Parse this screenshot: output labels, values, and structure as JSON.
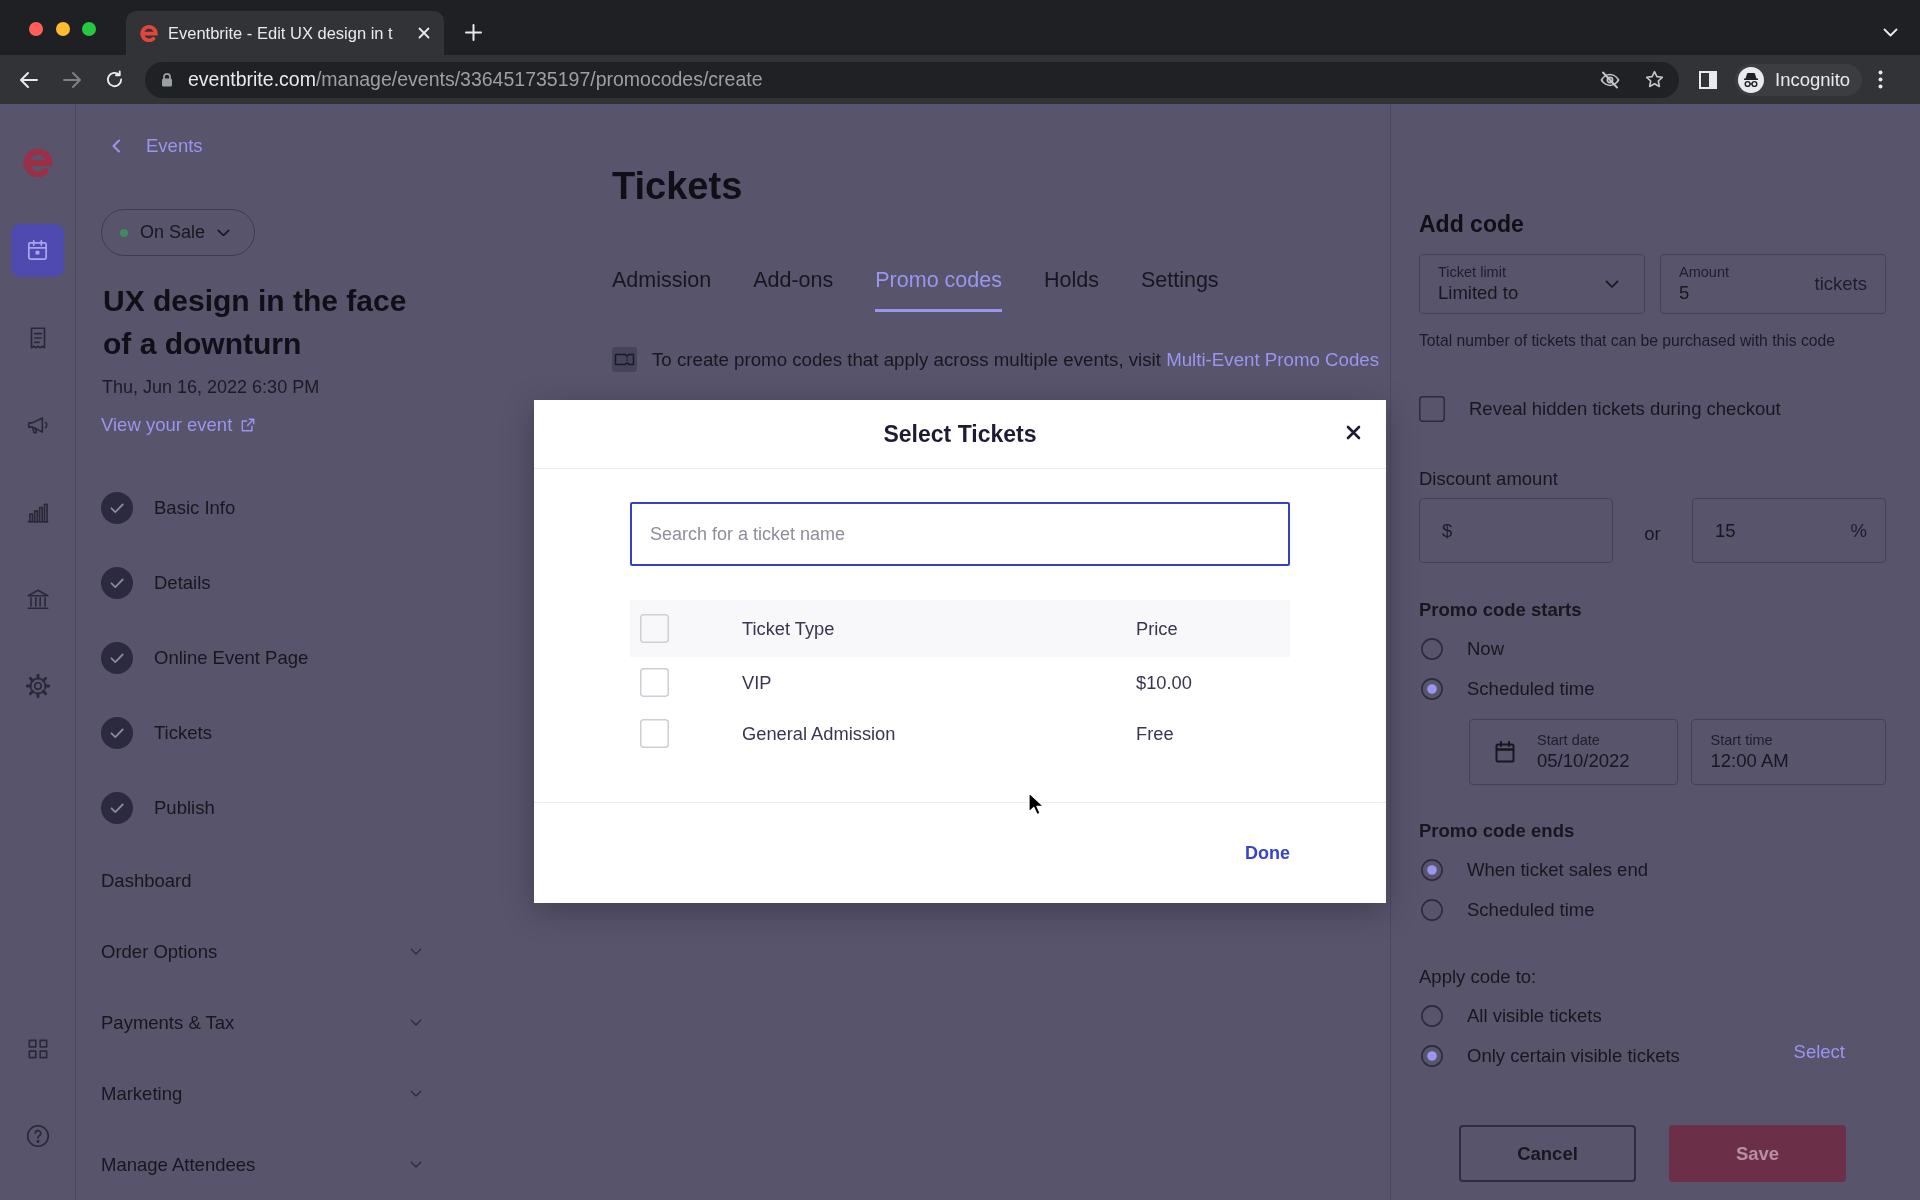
{
  "browser": {
    "tab_title": "Eventbrite - Edit UX design in t",
    "url_host": "eventbrite.com",
    "url_path": "/manage/events/336451735197/promocodes/create",
    "profile_label": "Incognito"
  },
  "rail": {
    "top": [
      {
        "selected": true
      },
      {
        "selected": false
      },
      {
        "selected": false
      },
      {
        "selected": false
      },
      {
        "selected": false
      },
      {
        "selected": false
      }
    ],
    "bottom": [
      {
        "selected": false
      },
      {
        "selected": false
      }
    ]
  },
  "event_nav": {
    "back_link": "Events",
    "status": "On Sale",
    "title": "UX design in the face of a downturn",
    "date": "Thu, Jun 16, 2022 6:30 PM",
    "view_link": "View your event",
    "steps": [
      {
        "label": "Basic Info",
        "done": true
      },
      {
        "label": "Details",
        "done": true
      },
      {
        "label": "Online Event Page",
        "done": true
      },
      {
        "label": "Tickets",
        "done": true
      },
      {
        "label": "Publish",
        "done": true
      }
    ],
    "sections": [
      {
        "label": "Dashboard",
        "expandable": false
      },
      {
        "label": "Order Options",
        "expandable": true
      },
      {
        "label": "Payments & Tax",
        "expandable": true
      },
      {
        "label": "Marketing",
        "expandable": true
      },
      {
        "label": "Manage Attendees",
        "expandable": true
      }
    ]
  },
  "page": {
    "title": "Tickets",
    "tabs": [
      {
        "label": "Admission",
        "selected": false
      },
      {
        "label": "Add-ons",
        "selected": false
      },
      {
        "label": "Promo codes",
        "selected": true
      },
      {
        "label": "Holds",
        "selected": false
      },
      {
        "label": "Settings",
        "selected": false
      }
    ],
    "notice": {
      "text": "To create promo codes that apply across multiple events, visit",
      "link": "Multi-Event Promo Codes"
    }
  },
  "add_code": {
    "title": "Add code",
    "ticket_limit": {
      "label": "Ticket limit",
      "value": "Limited to"
    },
    "amount": {
      "label": "Amount",
      "value": "5",
      "suffix": "tickets"
    },
    "limit_help": "Total number of tickets that can be purchased with this code",
    "reveal_hidden": {
      "label": "Reveal hidden tickets during checkout",
      "checked": false
    },
    "discount": {
      "label": "Discount amount",
      "amount_prefix": "$",
      "separator": "or",
      "percent_value": "15",
      "percent_suffix": "%"
    },
    "starts": {
      "label": "Promo code starts",
      "options": [
        {
          "label": "Now",
          "selected": false
        },
        {
          "label": "Scheduled time",
          "selected": true
        }
      ],
      "start_date": {
        "label": "Start date",
        "value": "05/10/2022"
      },
      "start_time": {
        "label": "Start time",
        "value": "12:00 AM"
      }
    },
    "ends": {
      "label": "Promo code ends",
      "options": [
        {
          "label": "When ticket sales end",
          "selected": true
        },
        {
          "label": "Scheduled time",
          "selected": false
        }
      ]
    },
    "apply": {
      "label": "Apply code to:",
      "options": [
        {
          "label": "All visible tickets",
          "selected": false
        },
        {
          "label": "Only certain visible tickets",
          "selected": true
        }
      ],
      "select_link": "Select"
    },
    "buttons": [
      {
        "label": "Cancel",
        "kind": "secondary"
      },
      {
        "label": "Save",
        "kind": "primary"
      }
    ]
  },
  "modal": {
    "title": "Select Tickets",
    "search": {
      "placeholder": "Search for a ticket name"
    },
    "select_all": {
      "checked": false
    },
    "columns": [
      "Ticket Type",
      "Price"
    ],
    "rows": [
      {
        "name": "VIP",
        "price": "$10.00",
        "checked": false
      },
      {
        "name": "General Admission",
        "price": "Free",
        "checked": false
      }
    ],
    "done": "Done"
  }
}
